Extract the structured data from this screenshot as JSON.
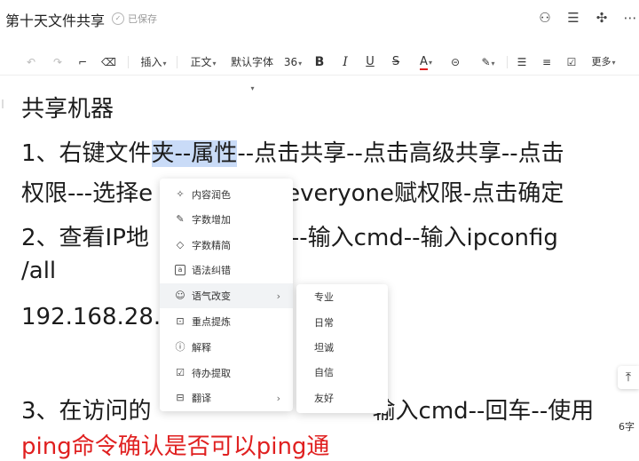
{
  "title": "第十天文件共享",
  "saved_status": "已保存",
  "topbar_icons": [
    "share-user-icon",
    "outline-search-icon",
    "collaborate-icon",
    "more-icon"
  ],
  "toolbar": {
    "insert": "插入",
    "paragraph": "正文",
    "font": "默认字体",
    "size": "36",
    "more": "更多"
  },
  "doc": {
    "heading": "共享机器",
    "line1a": "1、右键文件",
    "line1hl": "夹--属性",
    "line1b": "--点击共享--点击高级共享--点击",
    "line2a": "权限---选择e",
    "line2b": "给everyone赋权限-点击确定",
    "line3a": "2、查看IP地",
    "line3b": "行--输入cmd--输入ipconfig",
    "line4": "/all",
    "line5": "192.168.28.",
    "line6a": "3、在访问的",
    "line6b": "输入cmd--回车--使用",
    "line7": "ping命令确认是否可以ping通"
  },
  "menu": {
    "items": [
      {
        "label": "内容润色",
        "icon": "sparkle-icon"
      },
      {
        "label": "字数增加",
        "icon": "pen-icon"
      },
      {
        "label": "字数精简",
        "icon": "eraser-icon"
      },
      {
        "label": "语法纠错",
        "icon": "grammar-icon"
      },
      {
        "label": "语气改变",
        "icon": "smile-icon"
      },
      {
        "label": "重点提炼",
        "icon": "bookmark-icon"
      },
      {
        "label": "解释",
        "icon": "info-icon"
      },
      {
        "label": "待办提取",
        "icon": "checkbox-icon"
      },
      {
        "label": "翻译",
        "icon": "translate-icon"
      }
    ]
  },
  "submenu": {
    "items": [
      "专业",
      "日常",
      "坦诚",
      "自信",
      "友好"
    ]
  },
  "word_count": "6字"
}
